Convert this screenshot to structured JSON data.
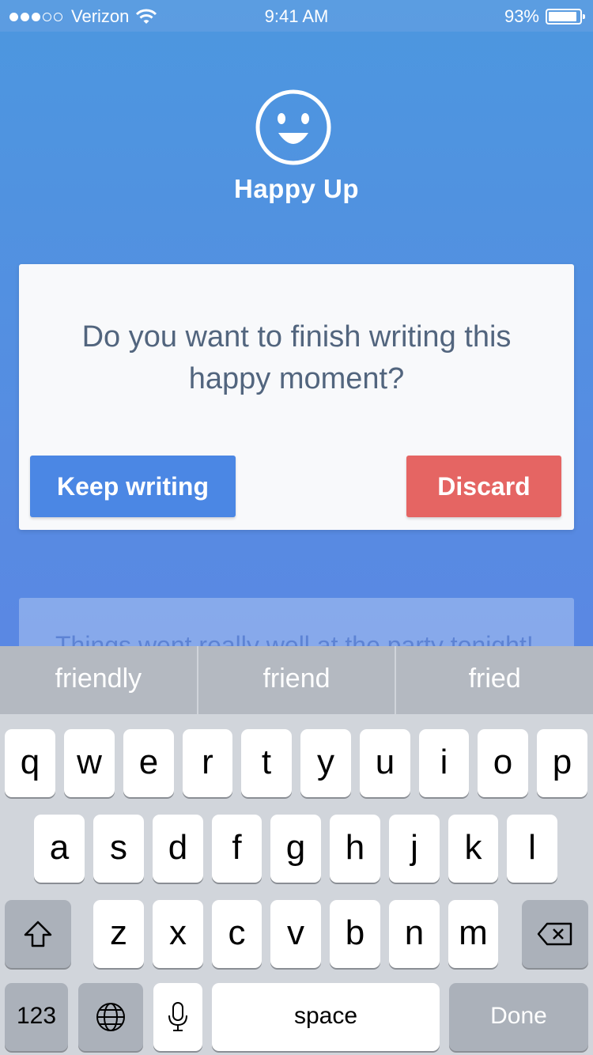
{
  "status_bar": {
    "carrier": "Verizon",
    "time": "9:41 AM",
    "battery": "93%",
    "battery_level": 0.93,
    "signal_bars_filled": 3,
    "signal_bars_total": 5
  },
  "app": {
    "title": "Happy Up",
    "logo_icon": "smiley-face-icon"
  },
  "dialog": {
    "message": "Do you want to finish writing this happy moment?",
    "keep_label": "Keep writing",
    "discard_label": "Discard",
    "keep_color": "#4b87e4",
    "discard_color": "#e56563"
  },
  "background_card": {
    "text": "Things went really well at the party tonight!"
  },
  "suggestions": [
    "friendly",
    "friend",
    "fried"
  ],
  "keyboard": {
    "row1": [
      "q",
      "w",
      "e",
      "r",
      "t",
      "y",
      "u",
      "i",
      "o",
      "p"
    ],
    "row2": [
      "a",
      "s",
      "d",
      "f",
      "g",
      "h",
      "j",
      "k",
      "l"
    ],
    "row3": [
      "z",
      "x",
      "c",
      "v",
      "b",
      "n",
      "m"
    ],
    "numbers_label": "123",
    "space_label": "space",
    "done_label": "Done"
  }
}
